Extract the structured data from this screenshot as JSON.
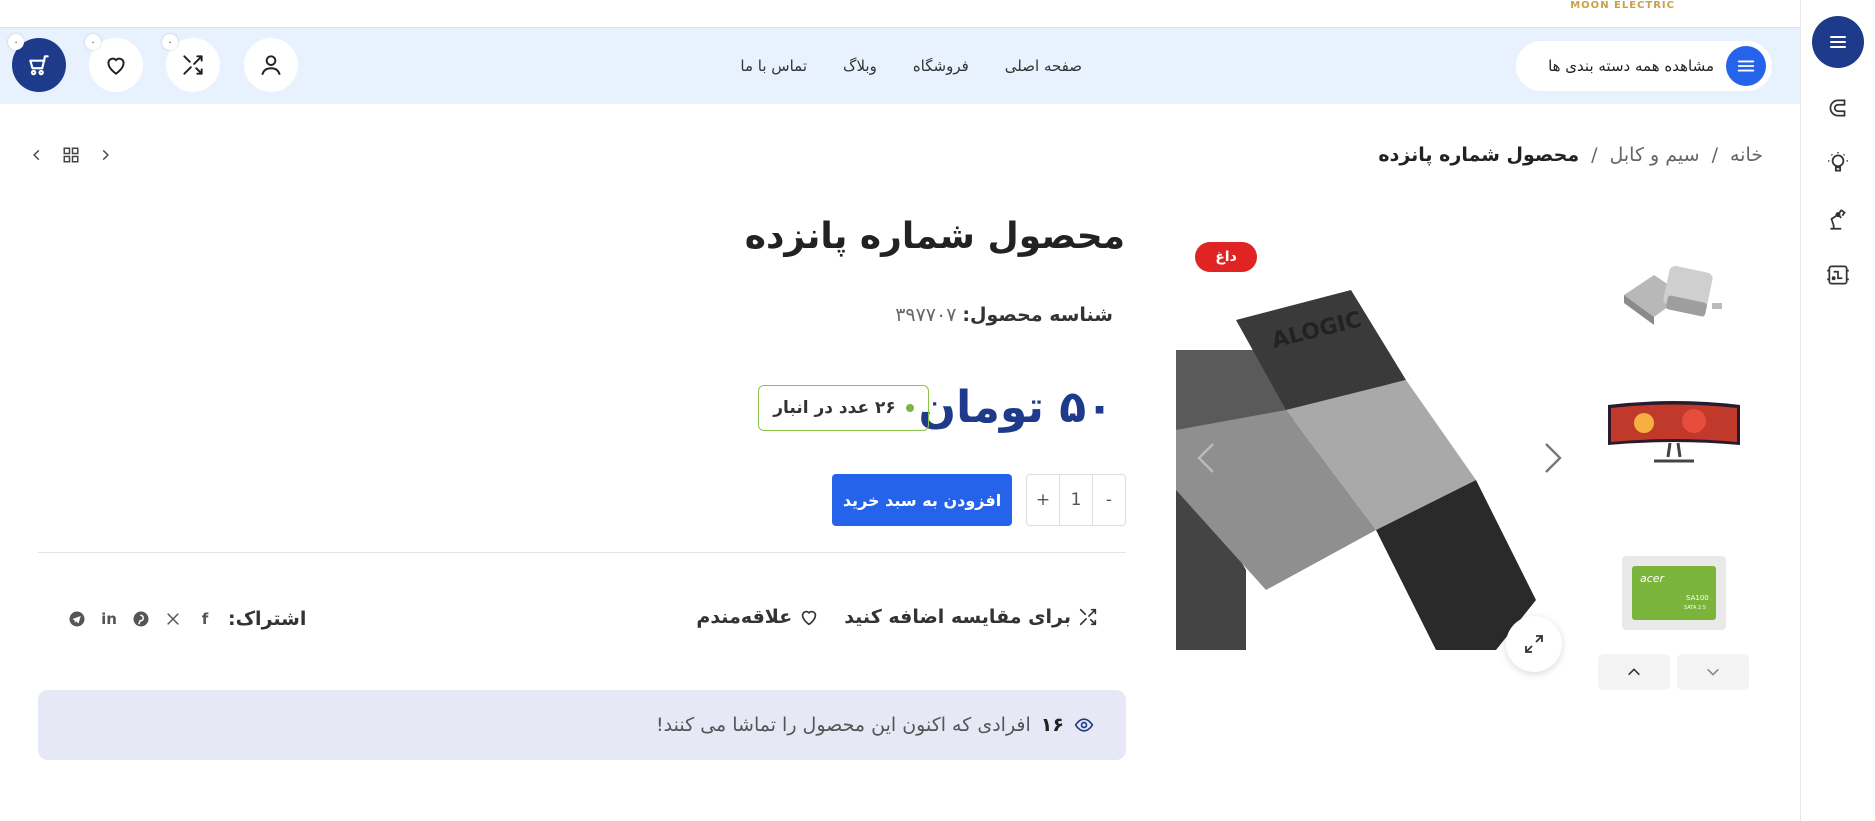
{
  "brand": {
    "logo_text": "MOON ELECTRIC"
  },
  "header": {
    "nav": [
      "صفحه اصلی",
      "فروشگاه",
      "وبلاگ",
      "تماس با ما"
    ],
    "categories_label": "مشاهده همه دسته بندی ها",
    "cart_count": "۰",
    "wishlist_count": "۰",
    "compare_count": "۰"
  },
  "breadcrumb": {
    "home": "خانه",
    "sep": "/",
    "category": "سیم و کابل",
    "current": "محصول شماره پانزده"
  },
  "product": {
    "badge": "داغ",
    "title": "محصول شماره پانزده",
    "sku_label": "شناسه محصول:",
    "sku_value": "۳۹۷۷۰۷",
    "price": "۵۰ تومان",
    "stock": "۲۶ عدد در انبار",
    "qty": "1",
    "qty_minus": "-",
    "qty_plus": "+",
    "add_to_cart": "افزودن به سبد خرید",
    "compare": "برای مقایسه اضافه کنید",
    "wishlist": "علاقه‌مندم",
    "share_label": "اشتراک:",
    "viewers_count": "۱۶",
    "viewers_text": "افرادی که اکنون این محصول را تماشا می کنند!"
  },
  "thumbnails": [
    {
      "name": "usb-adapter"
    },
    {
      "name": "curved-monitor"
    },
    {
      "name": "acer-ssd",
      "text_brand": "acer",
      "text_model": "SA100",
      "text_sub": "SATA 2.5"
    }
  ],
  "main_image": {
    "brand_text": "ALOGIC"
  },
  "colors": {
    "primary": "#1e3a8a",
    "accent": "#2563eb",
    "hot": "#e02424",
    "header_bg": "#e8f1fe",
    "stock": "#7cb342"
  }
}
